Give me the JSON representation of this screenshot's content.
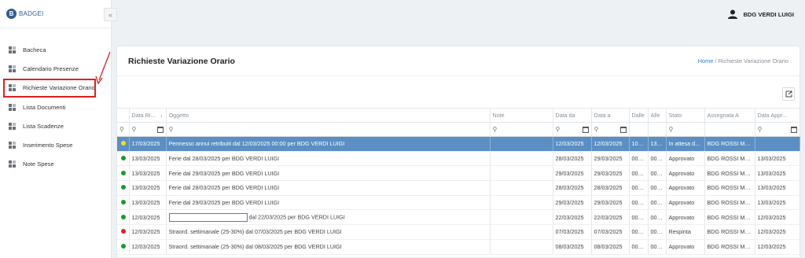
{
  "app": {
    "brand": "BADGEI",
    "logo_letter": "B",
    "collapse_glyph": "«"
  },
  "user": {
    "name": "BDG VERDI LUIGI"
  },
  "sidebar": {
    "items": [
      {
        "label": "Bacheca",
        "active": false
      },
      {
        "label": "Calendario Presenze",
        "active": false
      },
      {
        "label": "Richieste Variazione Orario",
        "active": true
      },
      {
        "label": "Lista Documenti",
        "active": false
      },
      {
        "label": "Lista Scadenze",
        "active": false
      },
      {
        "label": "Inserimento Spese",
        "active": false
      },
      {
        "label": "Note Spese",
        "active": false
      }
    ]
  },
  "page": {
    "title": "Richieste Variazione Orario",
    "breadcrumb_home": "Home",
    "breadcrumb_sep": " / ",
    "breadcrumb_current": "Richieste Variazione Orario"
  },
  "table": {
    "columns": [
      "",
      "Data Ri...",
      "Oggetto",
      "Note",
      "Data da",
      "Data a",
      "Dalle",
      "Alle",
      "Stato",
      "Assegnata A",
      "Data Appr..."
    ],
    "sort_glyph": "↓",
    "filter_icon": "⚲",
    "rows": [
      {
        "status_color": "#f2e01a",
        "data_richiesta": "17/03/2025",
        "oggetto": "Permesso annui retribuiti dal 12/03/2025 00:00 per BDG VERDI LUIGI",
        "note": "",
        "data_da": "12/03/2025",
        "data_a": "12/03/2025",
        "dalle": "10:00",
        "alle": "13:00",
        "stato": "In attesa d...",
        "assegnata": "BDG ROSSI MA...",
        "data_appr": "",
        "selected": true,
        "redacted": false
      },
      {
        "status_color": "#1a9a2a",
        "data_richiesta": "13/03/2025",
        "oggetto": "Ferie dal 28/03/2025 per BDG VERDI LUIGI",
        "note": "",
        "data_da": "28/03/2025",
        "data_a": "29/03/2025",
        "dalle": "00:00",
        "alle": "00:00",
        "stato": "Approvato",
        "assegnata": "BDG ROSSI MA...",
        "data_appr": "13/03/2025",
        "selected": false,
        "redacted": false
      },
      {
        "status_color": "#1a9a2a",
        "data_richiesta": "13/03/2025",
        "oggetto": "Ferie dal 29/03/2025 per BDG VERDI LUIGI",
        "note": "",
        "data_da": "29/03/2025",
        "data_a": "29/03/2025",
        "dalle": "00:00",
        "alle": "00:00",
        "stato": "Approvato",
        "assegnata": "BDG ROSSI MA...",
        "data_appr": "13/03/2025",
        "selected": false,
        "redacted": false
      },
      {
        "status_color": "#1a9a2a",
        "data_richiesta": "13/03/2025",
        "oggetto": "Ferie dal 28/03/2025 per BDG VERDI LUIGI",
        "note": "",
        "data_da": "28/03/2025",
        "data_a": "28/03/2025",
        "dalle": "00:00",
        "alle": "00:00",
        "stato": "Approvato",
        "assegnata": "BDG ROSSI MA...",
        "data_appr": "13/03/2025",
        "selected": false,
        "redacted": false
      },
      {
        "status_color": "#1a9a2a",
        "data_richiesta": "13/03/2025",
        "oggetto": "Ferie dal 29/03/2025 per BDG VERDI LUIGI",
        "note": "",
        "data_da": "29/03/2025",
        "data_a": "29/03/2025",
        "dalle": "00:00",
        "alle": "00:00",
        "stato": "Approvato",
        "assegnata": "BDG ROSSI MA...",
        "data_appr": "13/03/2025",
        "selected": false,
        "redacted": false
      },
      {
        "status_color": "#1a9a2a",
        "data_richiesta": "12/03/2025",
        "oggetto": "dal 22/03/2025 per BDG VERDI LUIGI",
        "note": "",
        "data_da": "22/03/2025",
        "data_a": "22/03/2025",
        "dalle": "00:00",
        "alle": "00:00",
        "stato": "Approvato",
        "assegnata": "BDG ROSSI MA...",
        "data_appr": "12/03/2025",
        "selected": false,
        "redacted": true
      },
      {
        "status_color": "#e02020",
        "data_richiesta": "12/03/2025",
        "oggetto": "Straord. settimanale (25-30%) dal 07/03/2025 per BDG VERDI LUIGI",
        "note": "",
        "data_da": "07/03/2025",
        "data_a": "07/03/2025",
        "dalle": "00:00",
        "alle": "00:00",
        "stato": "Respinta",
        "assegnata": "BDG ROSSI MA...",
        "data_appr": "12/03/2025",
        "selected": false,
        "redacted": false
      },
      {
        "status_color": "#1a9a2a",
        "data_richiesta": "12/03/2025",
        "oggetto": "Straord. settimanale (25-30%) dal 08/03/2025 per BDG VERDI LUIGI",
        "note": "",
        "data_da": "08/03/2025",
        "data_a": "08/03/2025",
        "dalle": "00:00",
        "alle": "00:00",
        "stato": "Approvato",
        "assegnata": "BDG ROSSI MA...",
        "data_appr": "12/03/2025",
        "selected": false,
        "redacted": false
      }
    ]
  }
}
